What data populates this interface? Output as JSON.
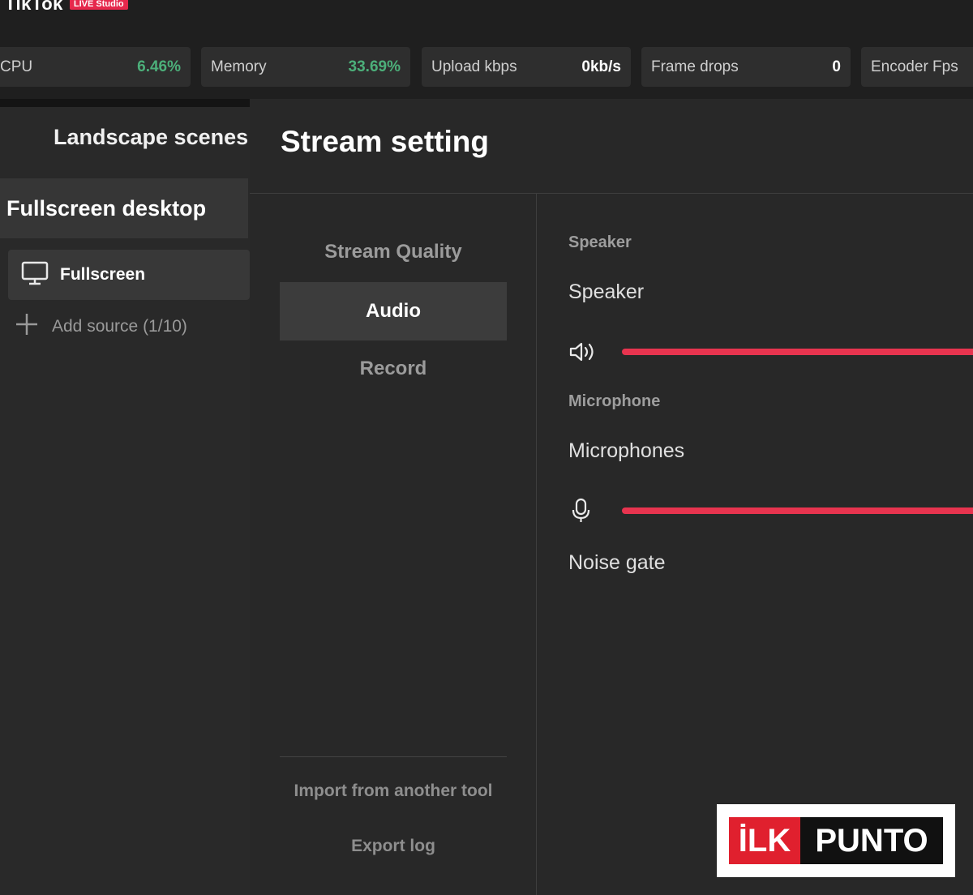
{
  "app": {
    "name": "TikTok",
    "badge": "LIVE Studio"
  },
  "stats": [
    {
      "label": "CPU",
      "value": "6.46%"
    },
    {
      "label": "Memory",
      "value": "33.69%"
    },
    {
      "label": "Upload kbps",
      "value": "0kb/s"
    },
    {
      "label": "Frame drops",
      "value": "0"
    },
    {
      "label": "Encoder Fps",
      "value": ""
    }
  ],
  "scenes": {
    "title": "Landscape scenes",
    "active_scene": "Fullscreen desktop",
    "sources": [
      {
        "label": "Fullscreen",
        "icon": "monitor-icon"
      }
    ],
    "add_source_label": "Add source (1/10)"
  },
  "settings": {
    "title": "Stream setting",
    "nav": [
      {
        "label": "Stream Quality",
        "active": false
      },
      {
        "label": "Audio",
        "active": true
      },
      {
        "label": "Record",
        "active": false
      }
    ],
    "import_label": "Import from another tool",
    "export_label": "Export log",
    "audio": {
      "speaker_section": "Speaker",
      "speaker_device": "Speaker",
      "microphone_section": "Microphone",
      "microphone_device": "Microphones",
      "noise_gate_label": "Noise gate"
    }
  },
  "watermark": {
    "left": "İLK",
    "right": "PUNTO"
  },
  "colors": {
    "accent": "#e8344f",
    "green": "#4caf7a",
    "background": "#1f1f1f"
  }
}
